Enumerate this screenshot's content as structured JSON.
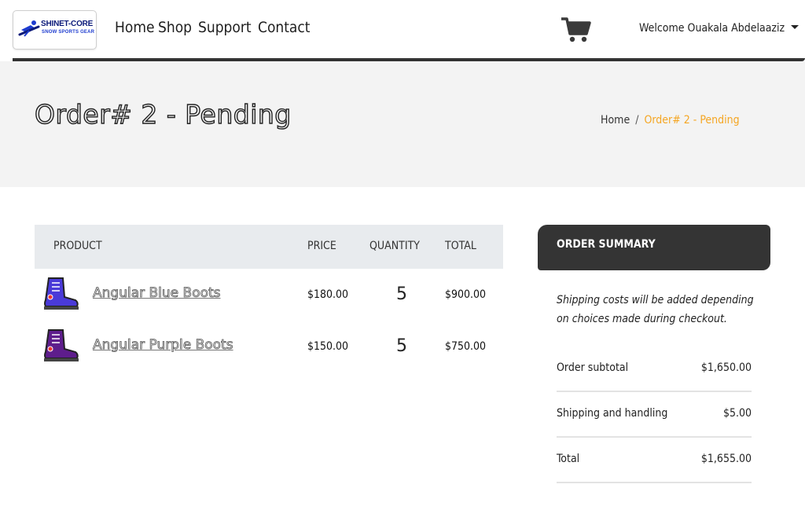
{
  "brand": {
    "logo_line1": "SHINET-CORE",
    "logo_line2": "SNOW SPORTS GEAR"
  },
  "nav": {
    "links": [
      "Home",
      "Shop",
      "Support",
      "Contact"
    ],
    "cart_icon": "shopping-cart-icon",
    "user_greeting": "Welcome Ouakala Abdelaaziz"
  },
  "page": {
    "title": "Order# 2 - Pending",
    "breadcrumb": {
      "home": "Home",
      "separator": "/",
      "current": "Order# 2 - Pending"
    }
  },
  "table": {
    "headers": [
      "PRODUCT",
      "PRICE",
      "QUANTITY",
      "TOTAL"
    ],
    "rows": [
      {
        "name": "Angular Blue Boots",
        "price": "$180.00",
        "quantity": "5",
        "total": "$900.00",
        "icon": "blue-boot-icon",
        "color": "#4a3ad8"
      },
      {
        "name": "Angular Purple Boots",
        "price": "$150.00",
        "quantity": "5",
        "total": "$750.00",
        "icon": "purple-boot-icon",
        "color": "#5e1d8c"
      }
    ]
  },
  "summary": {
    "title": "ORDER SUMMARY",
    "note": "Shipping costs will be added depending on choices made during checkout.",
    "rows": [
      {
        "label": "Order subtotal",
        "value": "$1,650.00"
      },
      {
        "label": "Shipping and handling",
        "value": "$5.00"
      },
      {
        "label": "Total",
        "value": "$1,655.00"
      }
    ]
  },
  "colors": {
    "accent": "#f5a623",
    "summary_header": "#343434",
    "table_header": "#e8ebee",
    "page_band": "#f3f3f3"
  }
}
